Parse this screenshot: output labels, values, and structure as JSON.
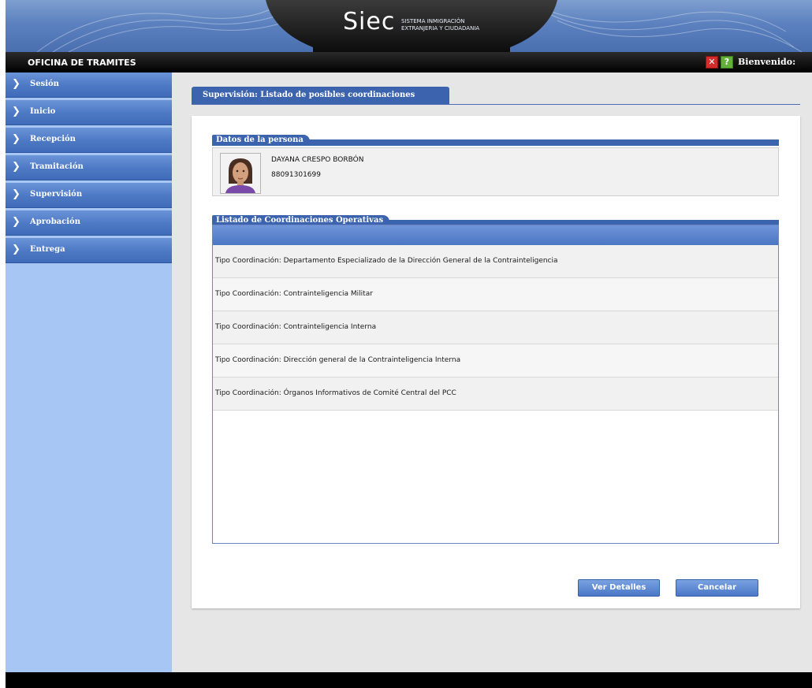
{
  "header": {
    "logo": "Siec",
    "logo_sub_line1": "SISTEMA INMIGRACIÓN",
    "logo_sub_line2": "EXTRANJERIA Y CIUDADANIA",
    "office_title": "OFICINA DE TRAMITES",
    "welcome": "Bienvenido:",
    "close_icon": "close-icon",
    "help_icon": "help-icon",
    "colors": {
      "banner": "#5c81bf",
      "topbar": "#000000"
    }
  },
  "sidebar": {
    "items": [
      {
        "label": "Sesión"
      },
      {
        "label": "Inicio"
      },
      {
        "label": "Recepción"
      },
      {
        "label": "Tramitación"
      },
      {
        "label": "Supervisión"
      },
      {
        "label": "Aprobación"
      },
      {
        "label": "Entrega"
      }
    ]
  },
  "main": {
    "tab_title": "Supervisión: Listado de posibles coordinaciones",
    "person_section": {
      "title": "Datos de la persona",
      "name": "DAYANA CRESPO BORBÓN",
      "id": "88091301699"
    },
    "list_section": {
      "title": "Listado de Coordinaciones Operativas",
      "rows": [
        "Tipo Coordinación: Departamento Especializado de la Dirección General de la Contrainteligencia",
        "Tipo Coordinación: Contrainteligencia Militar",
        "Tipo Coordinación: Contrainteligencia Interna",
        "Tipo Coordinación: Dirección general de la Contrainteligencia Interna",
        "Tipo Coordinación: Órganos Informativos de Comité Central del PCC"
      ]
    },
    "buttons": {
      "details": "Ver Detalles",
      "cancel": "Cancelar"
    }
  }
}
